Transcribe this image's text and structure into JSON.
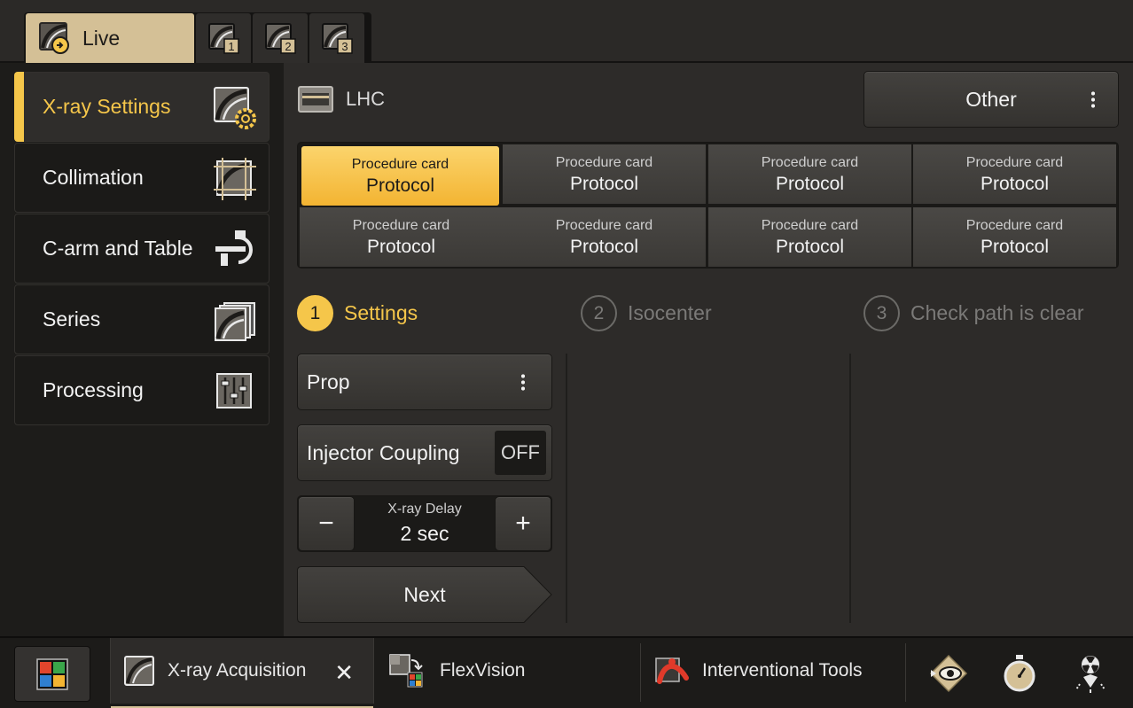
{
  "tabs": {
    "live_label": "Live",
    "numbered": [
      "1",
      "2",
      "3"
    ]
  },
  "sidebar": {
    "items": [
      {
        "label": "X-ray Settings",
        "icon": "xray-settings-icon",
        "active": true
      },
      {
        "label": "Collimation",
        "icon": "collimation-icon",
        "active": false
      },
      {
        "label": "C-arm and Table",
        "icon": "carm-table-icon",
        "active": false
      },
      {
        "label": "Series",
        "icon": "series-icon",
        "active": false
      },
      {
        "label": "Processing",
        "icon": "processing-sliders-icon",
        "active": false
      }
    ]
  },
  "header": {
    "location": "LHC",
    "other_label": "Other"
  },
  "procedure_cards": [
    {
      "title": "Procedure card",
      "subtitle": "Protocol",
      "selected": true
    },
    {
      "title": "Procedure card",
      "subtitle": "Protocol",
      "selected": false
    },
    {
      "title": "Procedure card",
      "subtitle": "Protocol",
      "selected": false
    },
    {
      "title": "Procedure card",
      "subtitle": "Protocol",
      "selected": false
    },
    {
      "title": "Procedure card",
      "subtitle": "Protocol",
      "selected": false
    },
    {
      "title": "Procedure card",
      "subtitle": "Protocol",
      "selected": false
    },
    {
      "title": "Procedure card",
      "subtitle": "Protocol",
      "selected": false
    },
    {
      "title": "Procedure card",
      "subtitle": "Protocol",
      "selected": false
    }
  ],
  "steps": [
    {
      "number": "1",
      "label": "Settings",
      "active": true
    },
    {
      "number": "2",
      "label": "Isocenter",
      "active": false
    },
    {
      "number": "3",
      "label": "Check path is clear",
      "active": false
    }
  ],
  "settings": {
    "prop_label": "Prop",
    "injector_label": "Injector Coupling",
    "injector_state": "OFF",
    "delay_label": "X-ray Delay",
    "delay_value": "2 sec",
    "minus": "−",
    "plus": "+",
    "next_label": "Next"
  },
  "taskbar": {
    "tasks": [
      {
        "label": "X-ray Acquisition",
        "active": true,
        "close": "✕"
      },
      {
        "label": "FlexVision",
        "active": false
      },
      {
        "label": "Interventional Tools",
        "active": false
      }
    ],
    "tray_icons": [
      "eye-view-icon",
      "stopwatch-icon",
      "radiation-icon"
    ]
  },
  "colors": {
    "accent": "#f5c64a",
    "live_tab": "#d4c096",
    "panel": "#2d2b29",
    "sidebar": "#1d1c1a"
  }
}
